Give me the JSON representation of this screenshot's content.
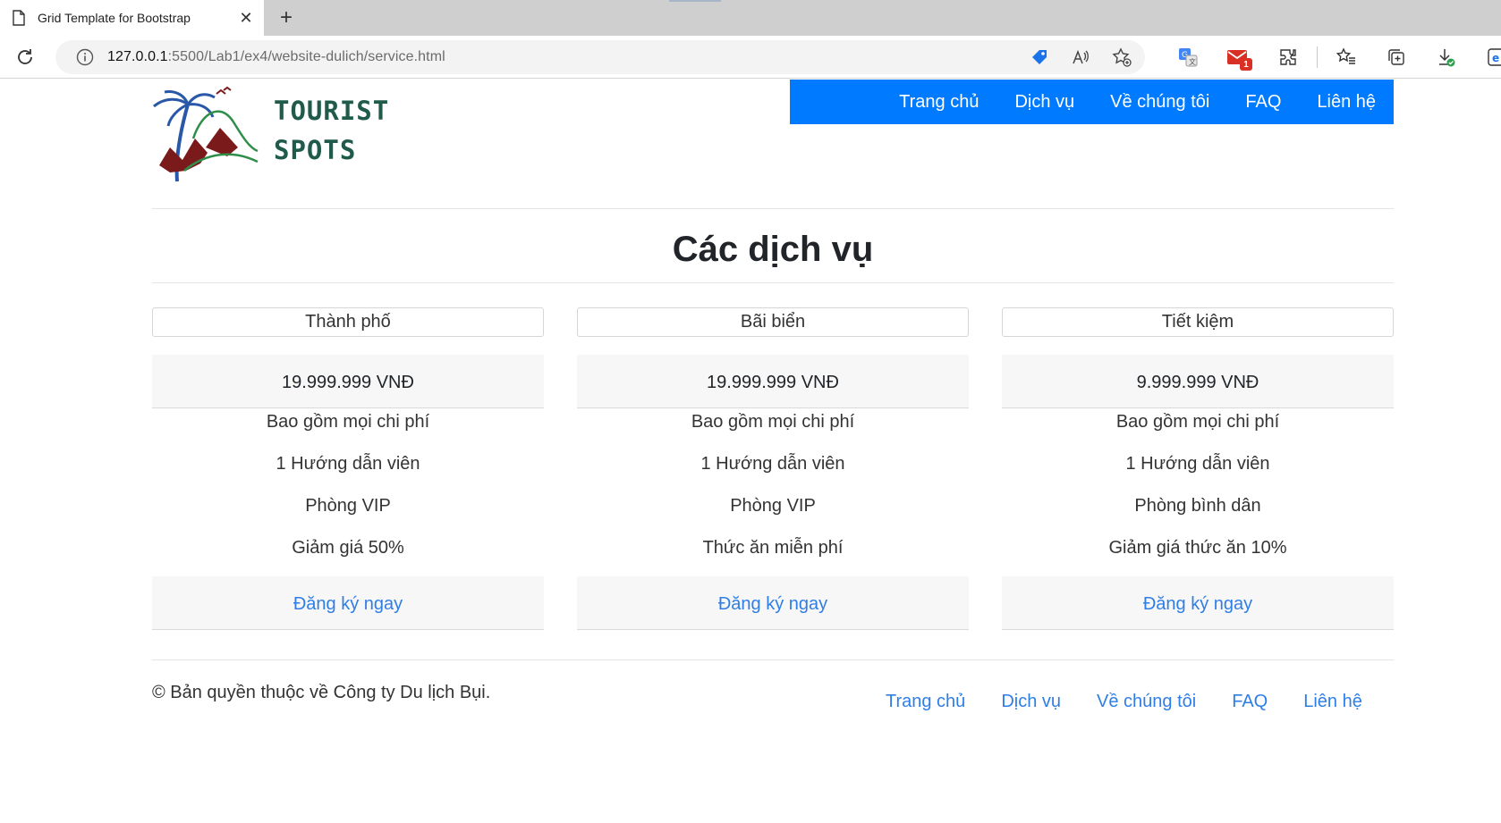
{
  "browser": {
    "tab_title": "Grid Template for Bootstrap",
    "url_host": "127.0.0.1",
    "url_rest": ":5500/Lab1/ex4/website-dulich/service.html",
    "mail_badge": "1"
  },
  "logo": {
    "line1": "TOURIST",
    "line2": "SPOTS"
  },
  "nav": {
    "items": [
      "Trang chủ",
      "Dịch vụ",
      "Về chúng tôi",
      "FAQ",
      "Liên hệ"
    ]
  },
  "main": {
    "heading": "Các dịch vụ",
    "cards": [
      {
        "title": "Thành phố",
        "price": "19.999.999 VNĐ",
        "features": [
          "Bao gồm mọi chi phí",
          "1 Hướng dẫn viên",
          "Phòng VIP",
          "Giảm giá 50%"
        ],
        "cta": "Đăng ký ngay"
      },
      {
        "title": "Bãi biển",
        "price": "19.999.999 VNĐ",
        "features": [
          "Bao gồm mọi chi phí",
          "1 Hướng dẫn viên",
          "Phòng VIP",
          "Thức ăn miễn phí"
        ],
        "cta": "Đăng ký ngay"
      },
      {
        "title": "Tiết kiệm",
        "price": "9.999.999 VNĐ",
        "features": [
          "Bao gồm mọi chi phí",
          "1 Hướng dẫn viên",
          "Phòng bình dân",
          "Giảm giá thức ăn 10%"
        ],
        "cta": "Đăng ký ngay"
      }
    ]
  },
  "footer": {
    "copyright": "© Bản quyền thuộc về Công ty Du lịch Bụi.",
    "links": [
      "Trang chủ",
      "Dịch vụ",
      "Về chúng tôi",
      "FAQ",
      "Liên hệ"
    ]
  },
  "colors": {
    "nav_bg": "#007bff",
    "link": "#2f7ee6",
    "card_bg": "#f7f7f7"
  }
}
